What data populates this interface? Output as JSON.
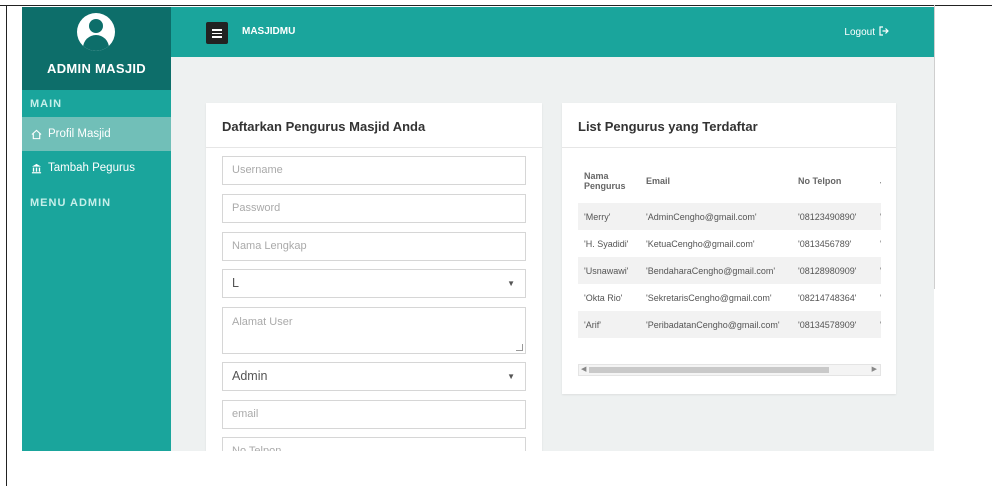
{
  "app": {
    "brand_title": "ADMIN MASJID",
    "name": "MASJIDMU",
    "logout_label": "Logout"
  },
  "sidebar": {
    "heading_main": "MAIN",
    "items": [
      {
        "label": "Profil Masjid",
        "icon": "home-icon",
        "active": true
      },
      {
        "label": "Tambah Pegurus",
        "icon": "bank-icon",
        "active": false
      }
    ],
    "heading_admin": "MENU ADMIN"
  },
  "form": {
    "title": "Daftarkan Pengurus Masjid Anda",
    "username_placeholder": "Username",
    "password_placeholder": "Password",
    "nama_placeholder": "Nama Lengkap",
    "gender_value": "L",
    "alamat_placeholder": "Alamat User",
    "role_value": "Admin",
    "email_placeholder": "email",
    "telpon_placeholder": "No Telpon"
  },
  "list": {
    "title": "List Pengurus yang Terdaftar",
    "columns": [
      "Nama Pengurus",
      "Email",
      "No Telpon",
      "Ja"
    ],
    "rows": [
      [
        "'Merry'",
        "'AdminCengho@gmail.com'",
        "'08123490890'",
        "'A"
      ],
      [
        "'H. Syadidi'",
        "'KetuaCengho@gmail.com'",
        "'0813456789'",
        "'K"
      ],
      [
        "'Usnawawi'",
        "'BendaharaCengho@gmail.com'",
        "'08128980909'",
        "'B"
      ],
      [
        "'Okta Rio'",
        "'SekretarisCengho@gmail.com'",
        "'08214748364'",
        "'S"
      ],
      [
        "'Arif'",
        "'PeribadatanCengho@gmail.com'",
        "'08134578909'",
        "'P"
      ]
    ]
  },
  "colors": {
    "accent": "#1aa59c",
    "brand_dark": "#0d6e6a",
    "active_item": "#71bfb8"
  }
}
